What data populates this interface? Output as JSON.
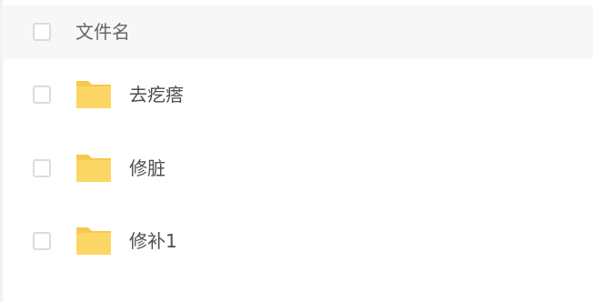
{
  "header": {
    "column_label": "文件名"
  },
  "files": [
    {
      "name": "去疙瘩",
      "icon": "folder-icon"
    },
    {
      "name": "修脏",
      "icon": "folder-icon"
    },
    {
      "name": "修补1",
      "icon": "folder-icon"
    }
  ],
  "colors": {
    "folder": "#fcd765",
    "folder_tab": "#f7c84e",
    "header_bg": "#f7f7f7",
    "checkbox_border": "#dcdcdc"
  }
}
